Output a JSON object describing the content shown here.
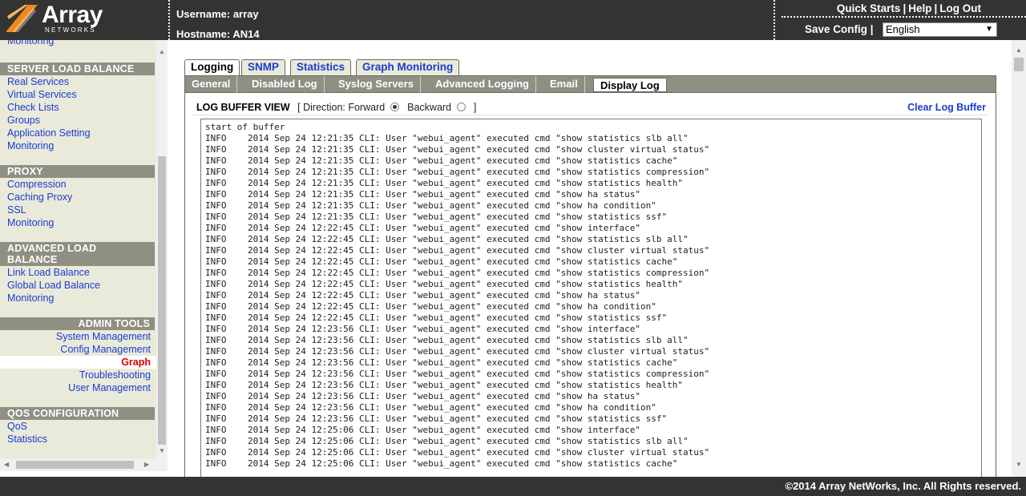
{
  "header": {
    "brand": "Array",
    "brand_sub": "NETWORKS",
    "username_label": "Username:",
    "username": "array",
    "hostname_label": "Hostname:",
    "hostname": "AN14",
    "quick_starts": "Quick Starts",
    "help": "Help",
    "logout": "Log Out",
    "save_config": "Save Config",
    "separator": "|",
    "language": "English"
  },
  "sidebar": {
    "partial_item": "Monitoring",
    "sections": [
      {
        "title": "SERVER LOAD BALANCE",
        "items": [
          "Real Services",
          "Virtual Services",
          "Check Lists",
          "Groups",
          "Application Setting",
          "Monitoring"
        ]
      },
      {
        "title": "PROXY",
        "items": [
          "Compression",
          "Caching Proxy",
          "SSL",
          "Monitoring"
        ]
      },
      {
        "title": "ADVANCED LOAD BALANCE",
        "items": [
          "Link Load Balance",
          "Global Load Balance",
          "Monitoring"
        ]
      },
      {
        "title": "ADMIN TOOLS",
        "items": [
          "System Management",
          "Config Management",
          "Graph",
          "Troubleshooting",
          "User Management"
        ]
      },
      {
        "title": "QOS CONFIGURATION",
        "items": [
          "QoS",
          "Statistics"
        ]
      }
    ]
  },
  "tabs_top": [
    "Logging",
    "SNMP",
    "Statistics",
    "Graph Monitoring"
  ],
  "tabs_sub": [
    "General",
    "Disabled Log",
    "Syslog Servers",
    "Advanced Logging",
    "Email",
    "Display Log"
  ],
  "log_view": {
    "title": "LOG BUFFER VIEW",
    "direction_prefix": "[ Direction: Forward",
    "backward": "Backward",
    "suffix": "]",
    "direction_selected": "Forward",
    "clear_label": "Clear Log Buffer"
  },
  "log_lines": [
    "start of buffer",
    "INFO    2014 Sep 24 12:21:35 CLI: User \"webui_agent\" executed cmd \"show statistics slb all\"",
    "INFO    2014 Sep 24 12:21:35 CLI: User \"webui_agent\" executed cmd \"show cluster virtual status\"",
    "INFO    2014 Sep 24 12:21:35 CLI: User \"webui_agent\" executed cmd \"show statistics cache\"",
    "INFO    2014 Sep 24 12:21:35 CLI: User \"webui_agent\" executed cmd \"show statistics compression\"",
    "INFO    2014 Sep 24 12:21:35 CLI: User \"webui_agent\" executed cmd \"show statistics health\"",
    "INFO    2014 Sep 24 12:21:35 CLI: User \"webui_agent\" executed cmd \"show ha status\"",
    "INFO    2014 Sep 24 12:21:35 CLI: User \"webui_agent\" executed cmd \"show ha condition\"",
    "INFO    2014 Sep 24 12:21:35 CLI: User \"webui_agent\" executed cmd \"show statistics ssf\"",
    "INFO    2014 Sep 24 12:22:45 CLI: User \"webui_agent\" executed cmd \"show interface\"",
    "INFO    2014 Sep 24 12:22:45 CLI: User \"webui_agent\" executed cmd \"show statistics slb all\"",
    "INFO    2014 Sep 24 12:22:45 CLI: User \"webui_agent\" executed cmd \"show cluster virtual status\"",
    "INFO    2014 Sep 24 12:22:45 CLI: User \"webui_agent\" executed cmd \"show statistics cache\"",
    "INFO    2014 Sep 24 12:22:45 CLI: User \"webui_agent\" executed cmd \"show statistics compression\"",
    "INFO    2014 Sep 24 12:22:45 CLI: User \"webui_agent\" executed cmd \"show statistics health\"",
    "INFO    2014 Sep 24 12:22:45 CLI: User \"webui_agent\" executed cmd \"show ha status\"",
    "INFO    2014 Sep 24 12:22:45 CLI: User \"webui_agent\" executed cmd \"show ha condition\"",
    "INFO    2014 Sep 24 12:22:45 CLI: User \"webui_agent\" executed cmd \"show statistics ssf\"",
    "INFO    2014 Sep 24 12:23:56 CLI: User \"webui_agent\" executed cmd \"show interface\"",
    "INFO    2014 Sep 24 12:23:56 CLI: User \"webui_agent\" executed cmd \"show statistics slb all\"",
    "INFO    2014 Sep 24 12:23:56 CLI: User \"webui_agent\" executed cmd \"show cluster virtual status\"",
    "INFO    2014 Sep 24 12:23:56 CLI: User \"webui_agent\" executed cmd \"show statistics cache\"",
    "INFO    2014 Sep 24 12:23:56 CLI: User \"webui_agent\" executed cmd \"show statistics compression\"",
    "INFO    2014 Sep 24 12:23:56 CLI: User \"webui_agent\" executed cmd \"show statistics health\"",
    "INFO    2014 Sep 24 12:23:56 CLI: User \"webui_agent\" executed cmd \"show ha status\"",
    "INFO    2014 Sep 24 12:23:56 CLI: User \"webui_agent\" executed cmd \"show ha condition\"",
    "INFO    2014 Sep 24 12:23:56 CLI: User \"webui_agent\" executed cmd \"show statistics ssf\"",
    "INFO    2014 Sep 24 12:25:06 CLI: User \"webui_agent\" executed cmd \"show interface\"",
    "INFO    2014 Sep 24 12:25:06 CLI: User \"webui_agent\" executed cmd \"show statistics slb all\"",
    "INFO    2014 Sep 24 12:25:06 CLI: User \"webui_agent\" executed cmd \"show cluster virtual status\"",
    "INFO    2014 Sep 24 12:25:06 CLI: User \"webui_agent\" executed cmd \"show statistics cache\""
  ],
  "footer": {
    "copyright": "©2014 Array NetWorks, Inc. All Rights reserved."
  },
  "colors": {
    "header_bg": "#333333",
    "sidebar_bg": "#eaeadb",
    "section_head_bg": "#8f8f83",
    "link": "#1a3ccf",
    "active_link": "#dd0000"
  }
}
